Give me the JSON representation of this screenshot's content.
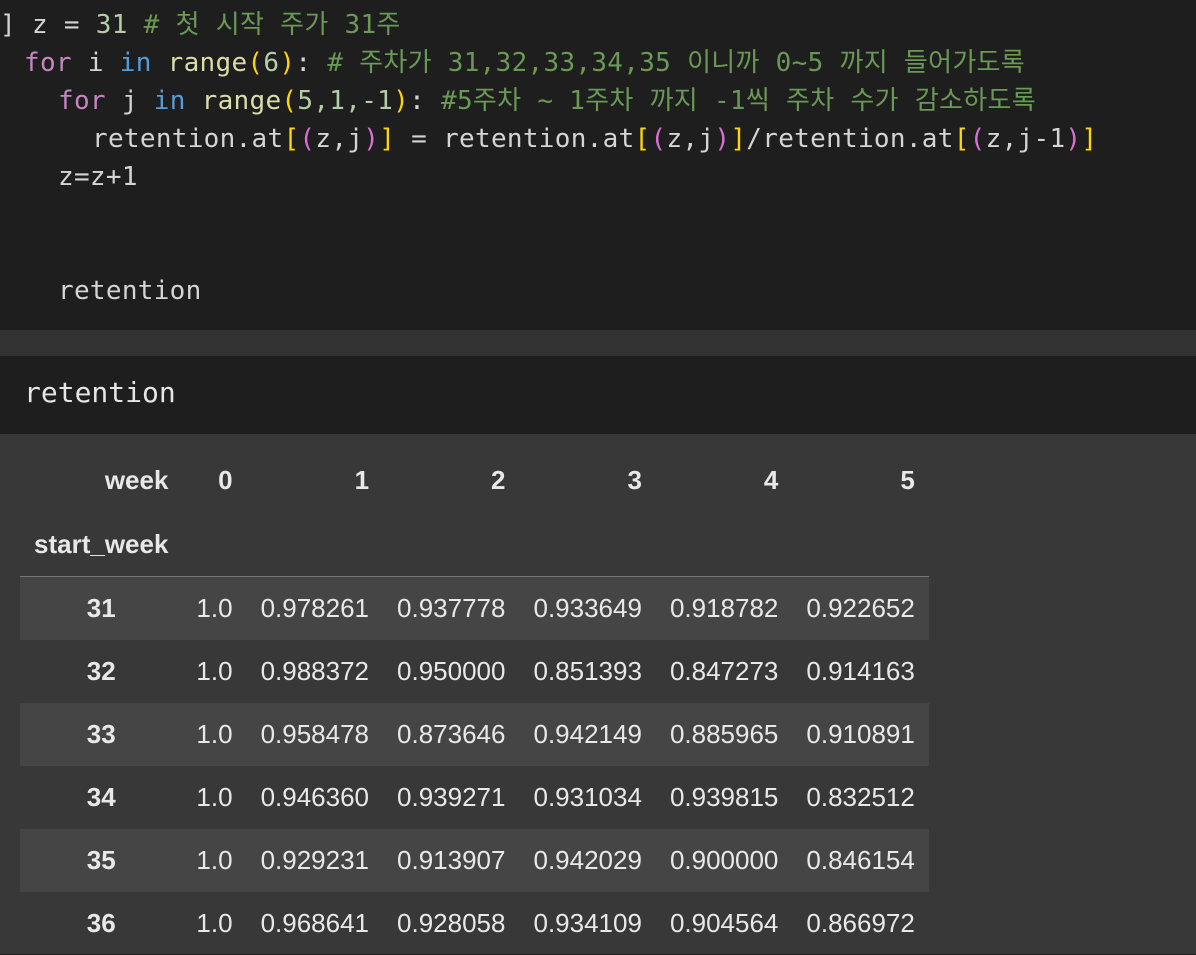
{
  "code": {
    "line1": {
      "prefix": "]",
      "a": "z = ",
      "n1": "31",
      "cm": "# 첫 시작 주가 31주"
    },
    "line2": {
      "for": "for",
      "i": " i ",
      "in": "in",
      "range": "range",
      "b1": "(",
      "n": "6",
      "b2": ")",
      "colon": ": ",
      "cm": "# 주차가 31,32,33,34,35 이니까 0~5 까지 들어가도록"
    },
    "line3": {
      "for": "for",
      "j": " j ",
      "in": "in",
      "range": "range",
      "b1": "(",
      "args": "5,1,-1",
      "b2": ")",
      "colon": ": ",
      "cm": "#5주차 ~ 1주차 까지 -1씩 주차 수가 감소하도록"
    },
    "line4": {
      "a": "retention.at",
      "b1": "[",
      "p1": "(",
      "v": "z,j",
      "p2": ")",
      "b2": "]",
      "eq": " = ",
      "c": "retention.at",
      "d1": "[",
      "q1": "(",
      "w": "z,j",
      "q2": ")",
      "d2": "]",
      "slash": "/",
      "e": "retention.at",
      "f1": "[",
      "r1": "(",
      "x": "z,j-1",
      "r2": ")",
      "f2": "]"
    },
    "line5": "z=z+1",
    "line6": "retention"
  },
  "output_header": "retention",
  "table": {
    "col_label": "week",
    "columns": [
      "0",
      "1",
      "2",
      "3",
      "4",
      "5"
    ],
    "index_label": "start_week",
    "rows": [
      {
        "index": "31",
        "values": [
          "1.0",
          "0.978261",
          "0.937778",
          "0.933649",
          "0.918782",
          "0.922652"
        ]
      },
      {
        "index": "32",
        "values": [
          "1.0",
          "0.988372",
          "0.950000",
          "0.851393",
          "0.847273",
          "0.914163"
        ]
      },
      {
        "index": "33",
        "values": [
          "1.0",
          "0.958478",
          "0.873646",
          "0.942149",
          "0.885965",
          "0.910891"
        ]
      },
      {
        "index": "34",
        "values": [
          "1.0",
          "0.946360",
          "0.939271",
          "0.931034",
          "0.939815",
          "0.832512"
        ]
      },
      {
        "index": "35",
        "values": [
          "1.0",
          "0.929231",
          "0.913907",
          "0.942029",
          "0.900000",
          "0.846154"
        ]
      },
      {
        "index": "36",
        "values": [
          "1.0",
          "0.968641",
          "0.928058",
          "0.934109",
          "0.904564",
          "0.866972"
        ]
      }
    ]
  }
}
